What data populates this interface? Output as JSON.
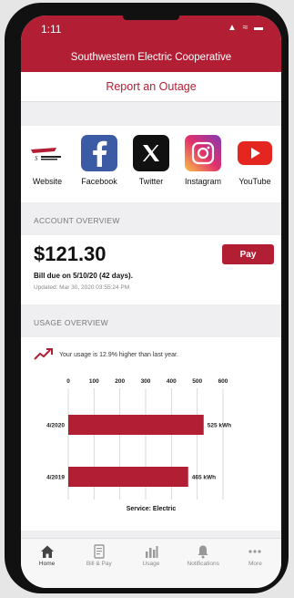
{
  "status": {
    "time": "1:11",
    "icons": "▲ ≈ ▬"
  },
  "header": {
    "title": "Southwestern Electric Cooperative"
  },
  "report": {
    "label": "Report an Outage"
  },
  "social": [
    {
      "label": "Website",
      "icon": "company-logo-icon"
    },
    {
      "label": "Facebook",
      "icon": "facebook-icon"
    },
    {
      "label": "Twitter",
      "icon": "twitter-x-icon"
    },
    {
      "label": "Instagram",
      "icon": "instagram-icon"
    },
    {
      "label": "YouTube",
      "icon": "youtube-icon"
    }
  ],
  "account": {
    "section": "ACCOUNT OVERVIEW",
    "amount": "$121.30",
    "due": "Bill due on 5/10/20 (42 days).",
    "updated": "Updated: Mar 30, 2020 03:55:24 PM",
    "pay_label": "Pay"
  },
  "usage": {
    "section": "USAGE OVERVIEW",
    "trend_text": "Your usage is 12.9% higher than last year.",
    "service": "Service: Electric"
  },
  "chart_data": {
    "type": "bar",
    "orientation": "horizontal",
    "categories": [
      "4/2020",
      "4/2019"
    ],
    "values": [
      525,
      465
    ],
    "value_labels": [
      "525 kWh",
      "465 kWh"
    ],
    "xticks": [
      "0",
      "100",
      "200",
      "300",
      "400",
      "500",
      "600"
    ],
    "xlim": [
      0,
      600
    ],
    "grid": true,
    "bar_color": "#b21f35"
  },
  "tabs": [
    {
      "label": "Home",
      "icon": "home-icon",
      "active": true
    },
    {
      "label": "Bill & Pay",
      "icon": "bill-icon",
      "active": false
    },
    {
      "label": "Usage",
      "icon": "usage-icon",
      "active": false
    },
    {
      "label": "Notifications",
      "icon": "bell-icon",
      "active": false
    },
    {
      "label": "More",
      "icon": "more-icon",
      "active": false
    }
  ],
  "colors": {
    "brand": "#b21f35"
  }
}
